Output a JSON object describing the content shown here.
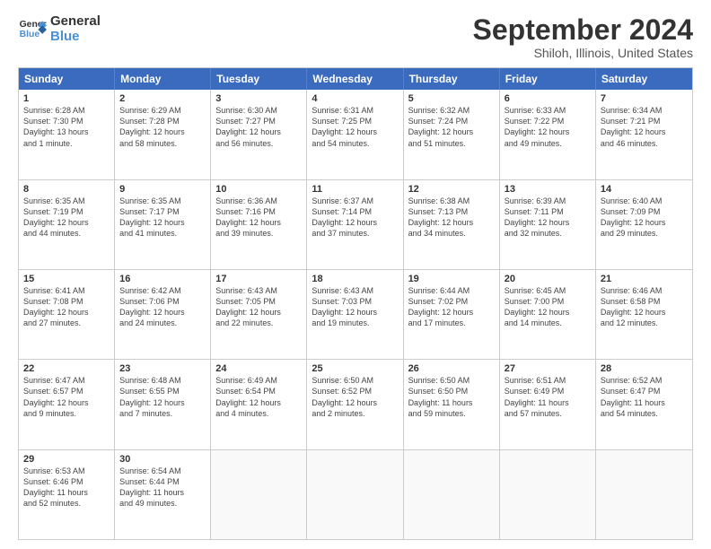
{
  "logo": {
    "line1": "General",
    "line2": "Blue"
  },
  "title": "September 2024",
  "subtitle": "Shiloh, Illinois, United States",
  "header_days": [
    "Sunday",
    "Monday",
    "Tuesday",
    "Wednesday",
    "Thursday",
    "Friday",
    "Saturday"
  ],
  "rows": [
    [
      {
        "day": "1",
        "text": "Sunrise: 6:28 AM\nSunset: 7:30 PM\nDaylight: 13 hours\nand 1 minute."
      },
      {
        "day": "2",
        "text": "Sunrise: 6:29 AM\nSunset: 7:28 PM\nDaylight: 12 hours\nand 58 minutes."
      },
      {
        "day": "3",
        "text": "Sunrise: 6:30 AM\nSunset: 7:27 PM\nDaylight: 12 hours\nand 56 minutes."
      },
      {
        "day": "4",
        "text": "Sunrise: 6:31 AM\nSunset: 7:25 PM\nDaylight: 12 hours\nand 54 minutes."
      },
      {
        "day": "5",
        "text": "Sunrise: 6:32 AM\nSunset: 7:24 PM\nDaylight: 12 hours\nand 51 minutes."
      },
      {
        "day": "6",
        "text": "Sunrise: 6:33 AM\nSunset: 7:22 PM\nDaylight: 12 hours\nand 49 minutes."
      },
      {
        "day": "7",
        "text": "Sunrise: 6:34 AM\nSunset: 7:21 PM\nDaylight: 12 hours\nand 46 minutes."
      }
    ],
    [
      {
        "day": "8",
        "text": "Sunrise: 6:35 AM\nSunset: 7:19 PM\nDaylight: 12 hours\nand 44 minutes."
      },
      {
        "day": "9",
        "text": "Sunrise: 6:35 AM\nSunset: 7:17 PM\nDaylight: 12 hours\nand 41 minutes."
      },
      {
        "day": "10",
        "text": "Sunrise: 6:36 AM\nSunset: 7:16 PM\nDaylight: 12 hours\nand 39 minutes."
      },
      {
        "day": "11",
        "text": "Sunrise: 6:37 AM\nSunset: 7:14 PM\nDaylight: 12 hours\nand 37 minutes."
      },
      {
        "day": "12",
        "text": "Sunrise: 6:38 AM\nSunset: 7:13 PM\nDaylight: 12 hours\nand 34 minutes."
      },
      {
        "day": "13",
        "text": "Sunrise: 6:39 AM\nSunset: 7:11 PM\nDaylight: 12 hours\nand 32 minutes."
      },
      {
        "day": "14",
        "text": "Sunrise: 6:40 AM\nSunset: 7:09 PM\nDaylight: 12 hours\nand 29 minutes."
      }
    ],
    [
      {
        "day": "15",
        "text": "Sunrise: 6:41 AM\nSunset: 7:08 PM\nDaylight: 12 hours\nand 27 minutes."
      },
      {
        "day": "16",
        "text": "Sunrise: 6:42 AM\nSunset: 7:06 PM\nDaylight: 12 hours\nand 24 minutes."
      },
      {
        "day": "17",
        "text": "Sunrise: 6:43 AM\nSunset: 7:05 PM\nDaylight: 12 hours\nand 22 minutes."
      },
      {
        "day": "18",
        "text": "Sunrise: 6:43 AM\nSunset: 7:03 PM\nDaylight: 12 hours\nand 19 minutes."
      },
      {
        "day": "19",
        "text": "Sunrise: 6:44 AM\nSunset: 7:02 PM\nDaylight: 12 hours\nand 17 minutes."
      },
      {
        "day": "20",
        "text": "Sunrise: 6:45 AM\nSunset: 7:00 PM\nDaylight: 12 hours\nand 14 minutes."
      },
      {
        "day": "21",
        "text": "Sunrise: 6:46 AM\nSunset: 6:58 PM\nDaylight: 12 hours\nand 12 minutes."
      }
    ],
    [
      {
        "day": "22",
        "text": "Sunrise: 6:47 AM\nSunset: 6:57 PM\nDaylight: 12 hours\nand 9 minutes."
      },
      {
        "day": "23",
        "text": "Sunrise: 6:48 AM\nSunset: 6:55 PM\nDaylight: 12 hours\nand 7 minutes."
      },
      {
        "day": "24",
        "text": "Sunrise: 6:49 AM\nSunset: 6:54 PM\nDaylight: 12 hours\nand 4 minutes."
      },
      {
        "day": "25",
        "text": "Sunrise: 6:50 AM\nSunset: 6:52 PM\nDaylight: 12 hours\nand 2 minutes."
      },
      {
        "day": "26",
        "text": "Sunrise: 6:50 AM\nSunset: 6:50 PM\nDaylight: 11 hours\nand 59 minutes."
      },
      {
        "day": "27",
        "text": "Sunrise: 6:51 AM\nSunset: 6:49 PM\nDaylight: 11 hours\nand 57 minutes."
      },
      {
        "day": "28",
        "text": "Sunrise: 6:52 AM\nSunset: 6:47 PM\nDaylight: 11 hours\nand 54 minutes."
      }
    ],
    [
      {
        "day": "29",
        "text": "Sunrise: 6:53 AM\nSunset: 6:46 PM\nDaylight: 11 hours\nand 52 minutes."
      },
      {
        "day": "30",
        "text": "Sunrise: 6:54 AM\nSunset: 6:44 PM\nDaylight: 11 hours\nand 49 minutes."
      },
      {
        "day": "",
        "text": ""
      },
      {
        "day": "",
        "text": ""
      },
      {
        "day": "",
        "text": ""
      },
      {
        "day": "",
        "text": ""
      },
      {
        "day": "",
        "text": ""
      }
    ]
  ]
}
